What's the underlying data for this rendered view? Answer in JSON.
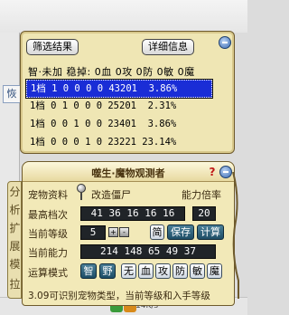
{
  "background": {
    "left_fragment": "恢",
    "tray_text": "14K/s"
  },
  "results": {
    "filter_button": "筛选结果",
    "detail_button": "详细信息",
    "column_header": "智·未加 稳掉: 0血 0攻 0防 0敏 0魔",
    "rows": [
      "1档 1 0 0 0 0 43201  3.86%",
      "1档 0 1 0 0 0 25201  2.31%",
      "1档 0 0 1 0 0 23401  3.86%",
      "1档 0 0 0 1 0 23221 23.14%"
    ],
    "selected_row": 0
  },
  "observer": {
    "title": "噬生·魔物观测者",
    "help_icon_text": "?",
    "pet_info_label": "宠物资料",
    "pet_name": "改造僵尸",
    "ability_ratio_label": "能力倍率",
    "max_tier_label": "最高档次",
    "max_tier_values": "41 36 16 16 16",
    "ratio_value": "20",
    "current_level_label": "当前等级",
    "current_level_value": "5",
    "simple_button": "简",
    "save_button": "保存",
    "calc_button": "计算",
    "current_ability_label": "当前能力",
    "current_ability_values": "214 148 65 49 37",
    "mode_label": "运算模式",
    "mode_buttons": [
      "智",
      "野",
      "无",
      "血",
      "攻",
      "防",
      "敏",
      "魔"
    ],
    "footer_text": "3.09可识别宠物类型，当前等级和入手等级"
  },
  "side_tabs": [
    "分",
    "析",
    "扩",
    "展",
    "模",
    "拉"
  ]
}
